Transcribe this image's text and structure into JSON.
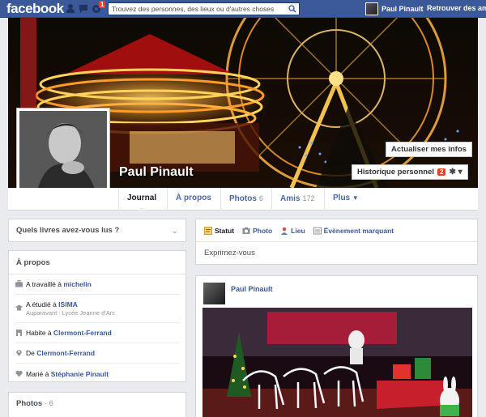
{
  "topbar": {
    "logo": "facebook",
    "search_placeholder": "Trouvez des personnes, des lieux ou d'autres choses",
    "notifications_count": "1",
    "user_name": "Paul Pinault",
    "find_friends": "Retrouver des amis"
  },
  "cover": {
    "update_info": "Actualiser mes infos",
    "history": "Historique personnel",
    "history_count": "2",
    "settings_icon": "gear-icon"
  },
  "profile": {
    "name": "Paul Pinault"
  },
  "tabs": [
    {
      "label": "Journal",
      "count": ""
    },
    {
      "label": "À propos",
      "count": ""
    },
    {
      "label": "Photos",
      "count": "6"
    },
    {
      "label": "Amis",
      "count": "172"
    },
    {
      "label": "Plus",
      "count": ""
    }
  ],
  "books": {
    "question": "Quels livres avez-vous lus ?"
  },
  "about": {
    "title": "À propos",
    "work": {
      "prefix": "A travaillé à ",
      "link": "michelin"
    },
    "study": {
      "prefix": "A étudié à ",
      "link": "ISIMA",
      "sub": "Auparavant : Lycée Jeanne d'Arc"
    },
    "lives": {
      "prefix": "Habite à ",
      "link": "Clermont-Ferrand"
    },
    "from": {
      "prefix": "De ",
      "link": "Clermont-Ferrand"
    },
    "married": {
      "prefix": "Marié à ",
      "link": "Stéphanie Pinault"
    }
  },
  "photos_panel": {
    "title": "Photos",
    "count": "· 6"
  },
  "composer": {
    "types": [
      "Statut",
      "Photo",
      "Lieu",
      "Évènement marquant"
    ],
    "placeholder": "Exprimez-vous"
  },
  "post": {
    "author": "Paul Pinault"
  },
  "colors": {
    "brand": "#3b5998",
    "badge": "#f03d25",
    "background": "#e9ebee"
  }
}
